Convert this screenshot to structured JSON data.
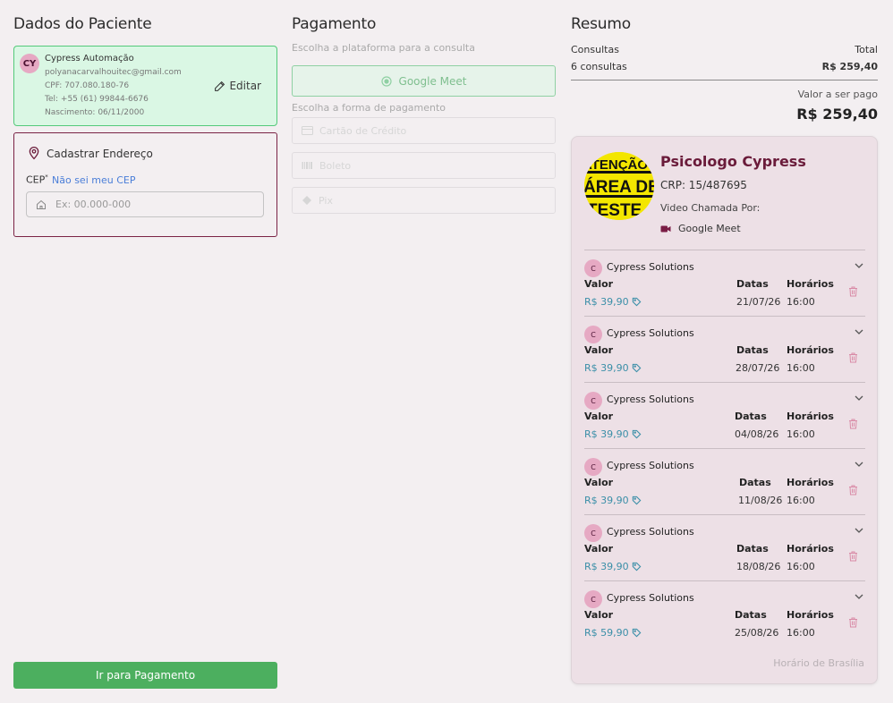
{
  "patient": {
    "section_title": "Dados do Paciente",
    "initials": "CY",
    "name": "Cypress Automação",
    "email": "polyanacarvalhouitec@gmail.com",
    "cpf": "CPF: 707.080.180-76",
    "phone": "Tel: +55 (61) 99844-6676",
    "birth": "Nascimento: 06/11/2000",
    "edit_label": "Editar"
  },
  "address": {
    "title": "Cadastrar Endereço",
    "cep_label": "CEP",
    "required_mark": "*",
    "cep_link": "Não sei meu CEP",
    "cep_placeholder": "Ex: 00.000-000"
  },
  "go_payment_label": "Ir para Pagamento",
  "payment": {
    "section_title": "Pagamento",
    "platform_hint": "Escolha a plataforma para a consulta",
    "platform_option": "Google Meet",
    "method_hint": "Escolha a forma de pagamento",
    "methods": [
      "Cartão de Crédito",
      "Boleto",
      "Pix"
    ]
  },
  "summary": {
    "section_title": "Resumo",
    "consultas_label": "Consultas",
    "total_label": "Total",
    "consultas_count": "6 consultas",
    "total_value": "R$ 259,40",
    "to_pay_label": "Valor a ser pago",
    "to_pay_value": "R$ 259,40"
  },
  "doctor": {
    "name": "Psicologo Cypress",
    "crp": "CRP: 15/487695",
    "call_via": "Video Chamada Por:",
    "platform": "Google Meet",
    "photo_text": [
      "ATENÇÃO",
      "ÁREA DE",
      "TESTE"
    ]
  },
  "slot_labels": {
    "value": "Valor",
    "dates": "Datas",
    "times": "Horários"
  },
  "slots": [
    {
      "initial": "C",
      "name": "Cypress Solutions",
      "price": "R$ 39,90",
      "date": "21/07/26",
      "time": "16:00"
    },
    {
      "initial": "C",
      "name": "Cypress Solutions",
      "price": "R$ 39,90",
      "date": "28/07/26",
      "time": "16:00"
    },
    {
      "initial": "C",
      "name": "Cypress Solutions",
      "price": "R$ 39,90",
      "date": "04/08/26",
      "time": "16:00"
    },
    {
      "initial": "C",
      "name": "Cypress Solutions",
      "price": "R$ 39,90",
      "date": "11/08/26",
      "time": "16:00"
    },
    {
      "initial": "C",
      "name": "Cypress Solutions",
      "price": "R$ 39,90",
      "date": "18/08/26",
      "time": "16:00"
    },
    {
      "initial": "C",
      "name": "Cypress Solutions",
      "price": "R$ 59,90",
      "date": "25/08/26",
      "time": "16:00"
    }
  ],
  "timezone_note": "Horário de Brasília"
}
